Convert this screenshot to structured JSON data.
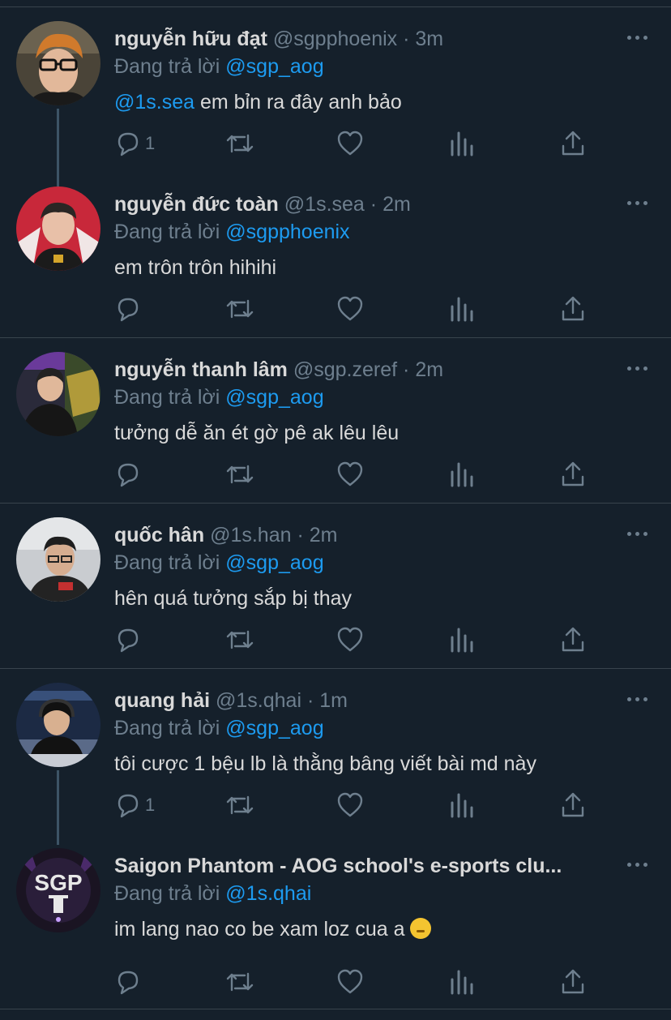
{
  "reply_prefix": "Đang trả lời",
  "tweets": [
    {
      "name": "nguyễn hữu đạt",
      "handle": "@sgpphoenix",
      "time": "3m",
      "reply_to": "@sgp_aog",
      "mention": "@1s.sea",
      "text": " em bỉn ra đây anh bảo",
      "reply_count": "1"
    },
    {
      "name": "nguyễn đức toàn",
      "handle": "@1s.sea",
      "time": "2m",
      "reply_to": "@sgpphoenix",
      "mention": "",
      "text": "em trôn trôn hihihi",
      "reply_count": ""
    },
    {
      "name": "nguyễn thanh lâm",
      "handle": "@sgp.zeref",
      "time": "2m",
      "reply_to": "@sgp_aog",
      "mention": "",
      "text": "tưởng dễ ăn ét gờ pê ak lêu lêu",
      "reply_count": ""
    },
    {
      "name": "quốc hân",
      "handle": "@1s.han",
      "time": "2m",
      "reply_to": "@sgp_aog",
      "mention": "",
      "text": "hên quá tưởng sắp bị thay",
      "reply_count": ""
    },
    {
      "name": "quang hải",
      "handle": "@1s.qhai",
      "time": "1m",
      "reply_to": "@sgp_aog",
      "mention": "",
      "text": "tôi cược 1 bệu lb là thằng bâng viết bài md này",
      "reply_count": "1"
    },
    {
      "name": "Saigon Phantom - AOG school's e-sports clu...",
      "handle": "",
      "time": "",
      "reply_to": "@1s.qhai",
      "mention": "",
      "text": "im lang nao co be xam loz cua a ",
      "reply_count": ""
    }
  ],
  "avatar_logo_text": "SGP",
  "colors": {
    "background": "#15202b",
    "accent": "#1d9bf0",
    "muted": "#6e7f8e",
    "divider": "#38444d"
  },
  "icons": [
    "reply-icon",
    "retweet-icon",
    "like-icon",
    "analytics-icon",
    "share-icon",
    "more-icon",
    "shushing-face-emoji"
  ]
}
